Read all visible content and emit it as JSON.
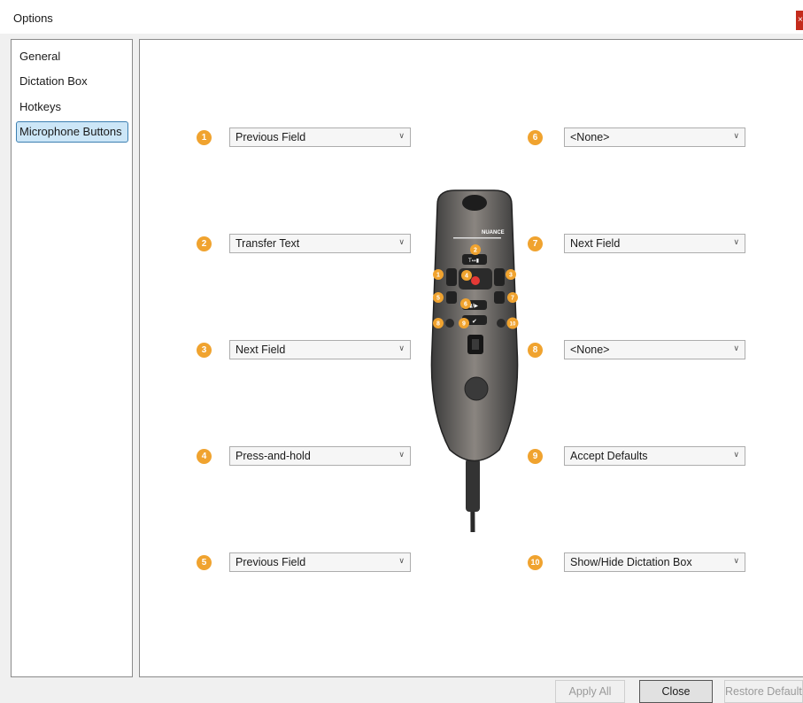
{
  "window": {
    "title": "Options",
    "close_glyph": "×"
  },
  "sidebar": {
    "items": [
      {
        "label": "General"
      },
      {
        "label": "Dictation Box"
      },
      {
        "label": "Hotkeys"
      },
      {
        "label": "Microphone Buttons",
        "selected": true
      }
    ]
  },
  "buttons_left": [
    {
      "number": "1",
      "value": "Previous Field"
    },
    {
      "number": "2",
      "value": "Transfer Text"
    },
    {
      "number": "3",
      "value": "Next Field"
    },
    {
      "number": "4",
      "value": "Press-and-hold"
    },
    {
      "number": "5",
      "value": "Previous Field"
    }
  ],
  "buttons_right": [
    {
      "number": "6",
      "value": "<None>"
    },
    {
      "number": "7",
      "value": "Next Field"
    },
    {
      "number": "8",
      "value": "<None>"
    },
    {
      "number": "9",
      "value": "Accept Defaults"
    },
    {
      "number": "10",
      "value": "Show/Hide Dictation Box"
    }
  ],
  "device": {
    "brand": "NUANCE",
    "badges": [
      "1",
      "2",
      "3",
      "4",
      "5",
      "6",
      "7",
      "8",
      "9",
      "10"
    ],
    "button_glyphs": {
      "transfer": "T↔▮",
      "play": "▮/▶",
      "check": "✔"
    }
  },
  "footer": {
    "apply_all": "Apply All",
    "close": "Close",
    "restore_defaults": "Restore Defaults"
  },
  "colors": {
    "accent": "#f0a32f",
    "selection": "#cce6f7",
    "close_red": "#c42b1c"
  }
}
